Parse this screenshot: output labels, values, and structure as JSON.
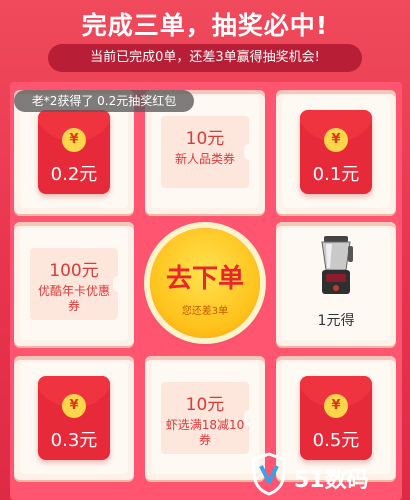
{
  "header": {
    "title": "完成三单，抽奖必中!",
    "subtitle": "当前已完成0单，还差3单赢得抽奖机会!"
  },
  "toast": "老*2获得了 0.2元抽奖红包",
  "cells": {
    "r1c1": {
      "amount": "0.2元"
    },
    "r1c2": {
      "value": "10元",
      "desc": "新人品类券"
    },
    "r1c3": {
      "amount": "0.1元"
    },
    "r2c1": {
      "value": "100元",
      "desc": "优酷年卡优惠券"
    },
    "r2c3": {
      "label": "1元得"
    },
    "r3c1": {
      "amount": "0.3元"
    },
    "r3c2": {
      "value": "10元",
      "desc": "虾选满18减10券"
    },
    "r3c3": {
      "amount": "0.5元"
    }
  },
  "center_button": {
    "label": "去下单",
    "sub": "您还差3单"
  },
  "watermark": {
    "brand": "51数码"
  },
  "icons": {
    "yen": "¥"
  },
  "colors": {
    "background": "#f04a5c",
    "redpacket": "#e72a3a",
    "button": "#ffc21b"
  }
}
